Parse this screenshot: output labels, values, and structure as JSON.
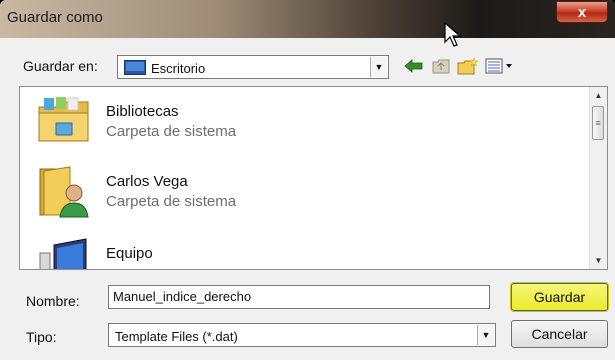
{
  "window": {
    "title": "Guardar como"
  },
  "location": {
    "label": "Guardar en:",
    "value": "Escritorio"
  },
  "files": [
    {
      "name": "Bibliotecas",
      "type": "Carpeta de sistema"
    },
    {
      "name": "Carlos Vega",
      "type": "Carpeta de sistema"
    },
    {
      "name": "Equipo",
      "type": ""
    }
  ],
  "form": {
    "name_label": "Nombre:",
    "name_value": "Manuel_indice_derecho",
    "type_label": "Tipo:",
    "type_value": "Template Files (*.dat)"
  },
  "buttons": {
    "save": "Guardar",
    "cancel": "Cancelar",
    "close": "x"
  },
  "colors": {
    "save_highlight": "#f0f03a"
  }
}
